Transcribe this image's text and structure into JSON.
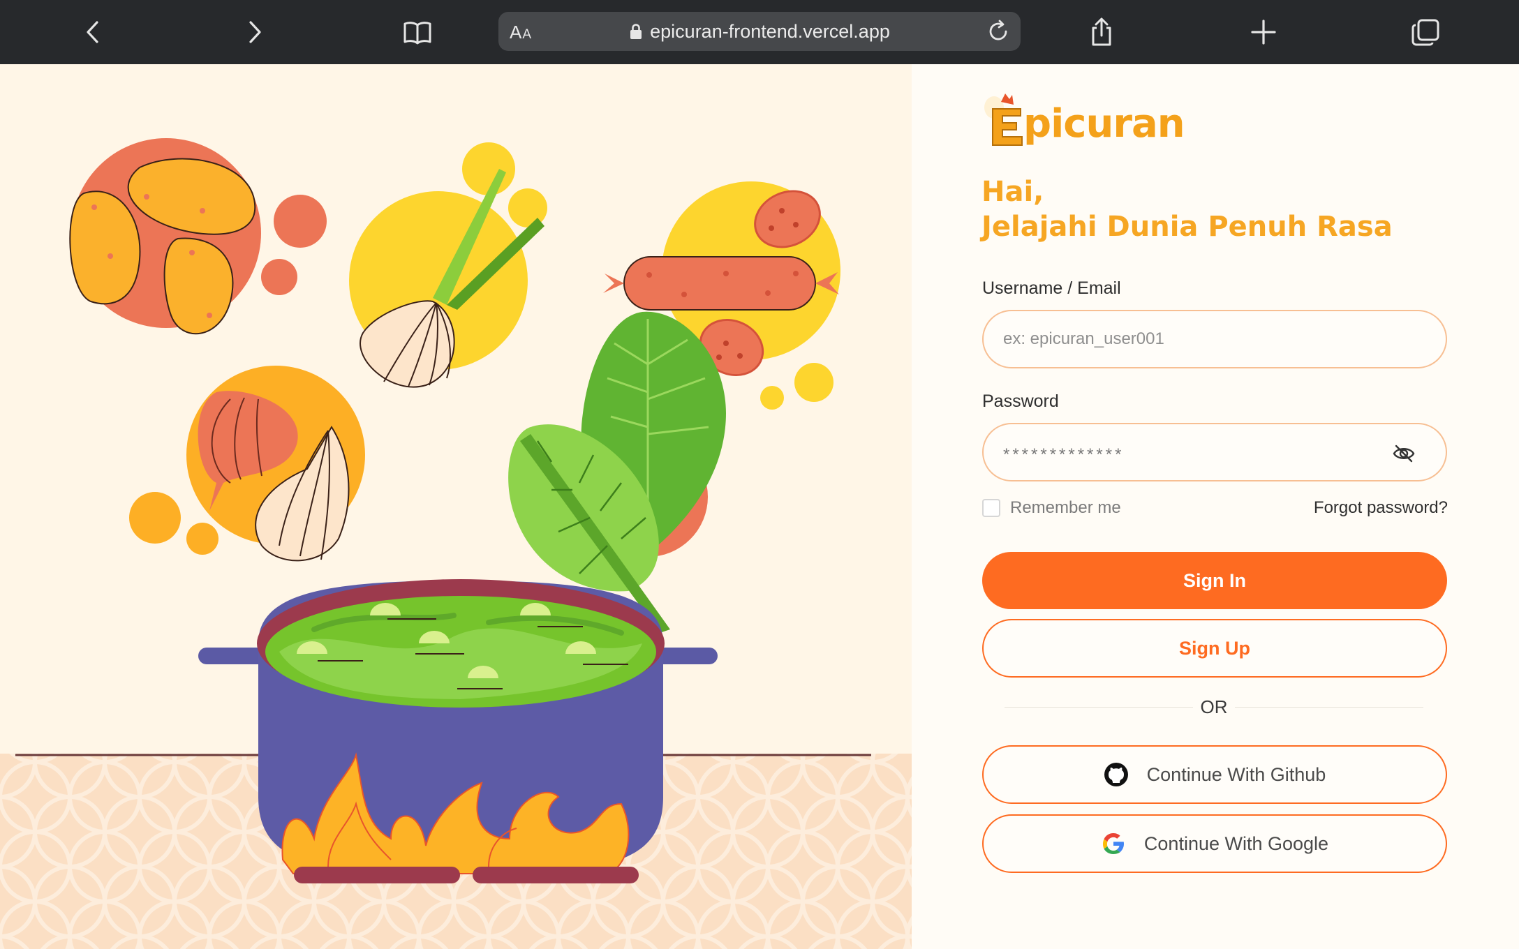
{
  "browser": {
    "aa_label": "AA",
    "url": "epicuran-frontend.vercel.app",
    "icons": [
      "back-icon",
      "forward-icon",
      "bookmarks-icon",
      "lock-icon",
      "reload-icon",
      "share-icon",
      "new-tab-icon",
      "tabs-icon"
    ]
  },
  "brand": {
    "name": "picuran",
    "logo_letter": "E",
    "primary_color": "#fe6b21",
    "accent_color": "#f6a623"
  },
  "greeting": {
    "line1": "Hai,",
    "line2": "Jelajahi Dunia Penuh Rasa"
  },
  "form": {
    "username_label": "Username / Email",
    "username_placeholder": "ex: epicuran_user001",
    "username_value": "",
    "password_label": "Password",
    "password_mask": "*************",
    "remember_label": "Remember me",
    "remember_checked": false,
    "forgot_label": "Forgot password?",
    "signin_label": "Sign In",
    "signup_label": "Sign Up",
    "or_label": "OR",
    "github_label": "Continue With Github",
    "google_label": "Continue With Google"
  }
}
